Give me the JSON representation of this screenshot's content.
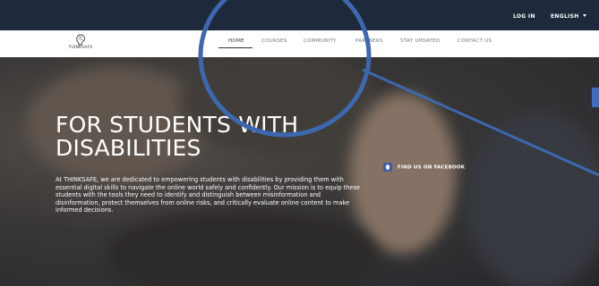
{
  "topbar": {
    "login_label": "LOG IN",
    "language_label": "ENGLISH"
  },
  "logo": {
    "text": "THINKSAFE"
  },
  "nav": {
    "items": [
      {
        "label": "HOME",
        "active": true
      },
      {
        "label": "COURSES"
      },
      {
        "label": "COMMUNITY"
      },
      {
        "label": "PARTNERS"
      },
      {
        "label": "STAY UPDATED"
      },
      {
        "label": "CONTACT US"
      }
    ]
  },
  "hero": {
    "title_line1": "FOR STUDENTS WITH",
    "title_line2": "DISABILITIES",
    "description": "At THINKSAFE, we are dedicated to empowering students with disabilities by providing them with essential digital skills to navigate the online world safely and confidently. Our mission is to equip these students with the tools they need to identify and distinguish between misinformation and disinformation, protect themselves from online risks, and critically evaluate online content to make informed decisions."
  },
  "social": {
    "facebook_label": "FIND US ON FACEBOOK",
    "icon": "facebook-icon"
  },
  "colors": {
    "topbar": "#1e2a3c",
    "navbar": "#ffffff",
    "annotation": "#3d68b0",
    "facebook": "#3b5ea5"
  }
}
